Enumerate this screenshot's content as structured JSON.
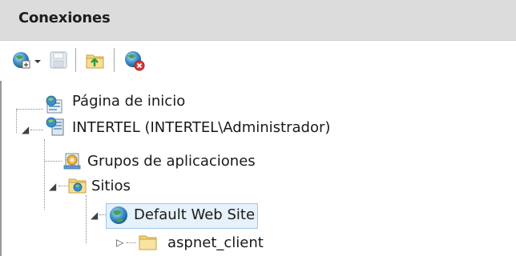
{
  "panel": {
    "title": "Conexiones"
  },
  "toolbar": {
    "buttons": [
      {
        "icon": "connect-globe-icon",
        "has_dropdown": true
      },
      {
        "icon": "save-icon"
      },
      {
        "icon": "up-folder-icon"
      },
      {
        "icon": "disconnect-globe-icon"
      }
    ]
  },
  "tree": {
    "nodes": [
      {
        "label": "Página de inicio",
        "icon": "start-page-icon",
        "expander": ""
      },
      {
        "label": "INTERTEL (INTERTEL\\Administrador)",
        "icon": "server-icon",
        "expander": "◢"
      },
      {
        "label": "Grupos de aplicaciones",
        "icon": "app-pools-icon",
        "expander": ""
      },
      {
        "label": "Sitios",
        "icon": "sites-folder-icon",
        "expander": "◢"
      },
      {
        "label": "Default Web Site",
        "icon": "website-globe-icon",
        "expander": "◢",
        "selected": true
      },
      {
        "label": "aspnet_client",
        "icon": "folder-icon",
        "expander": "▷"
      }
    ]
  },
  "colors": {
    "header_bg": "#dcdcdc",
    "selection_bg": "#e5f1fb",
    "selection_border": "#a0c8ec"
  }
}
